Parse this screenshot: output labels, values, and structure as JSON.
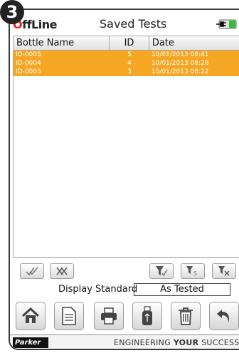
{
  "step_number": "3",
  "header": {
    "logo_o": "O",
    "logo_rest": "ffLine",
    "title": "Saved Tests",
    "power_icon": "plug-battery-icon"
  },
  "table": {
    "columns": [
      "Bottle Name",
      "ID",
      "Date"
    ],
    "rows": [
      {
        "name": "ID-0005",
        "id": "5",
        "date": "10/01/2013 08:41"
      },
      {
        "name": "ID-0004",
        "id": "4",
        "date": "10/01/2013 08:28"
      },
      {
        "name": "ID-0003",
        "id": "3",
        "date": "10/01/2013 08:22"
      }
    ],
    "selected_row_color": "#f5a623"
  },
  "filter_buttons": [
    "select-all-icon",
    "deselect-all-icon",
    "filter-icon",
    "filter-clear-icon",
    "filter-remove-icon"
  ],
  "display_standard": {
    "label": "Display Standard",
    "value": "As Tested"
  },
  "action_buttons": [
    "home-icon",
    "document-icon",
    "print-icon",
    "usb-icon",
    "trash-icon",
    "back-icon"
  ],
  "footer": {
    "brand": "Parker",
    "tagline_normal": "ENGINEERING ",
    "tagline_bold": "YOUR",
    "tagline_end": " SUCCESS"
  }
}
